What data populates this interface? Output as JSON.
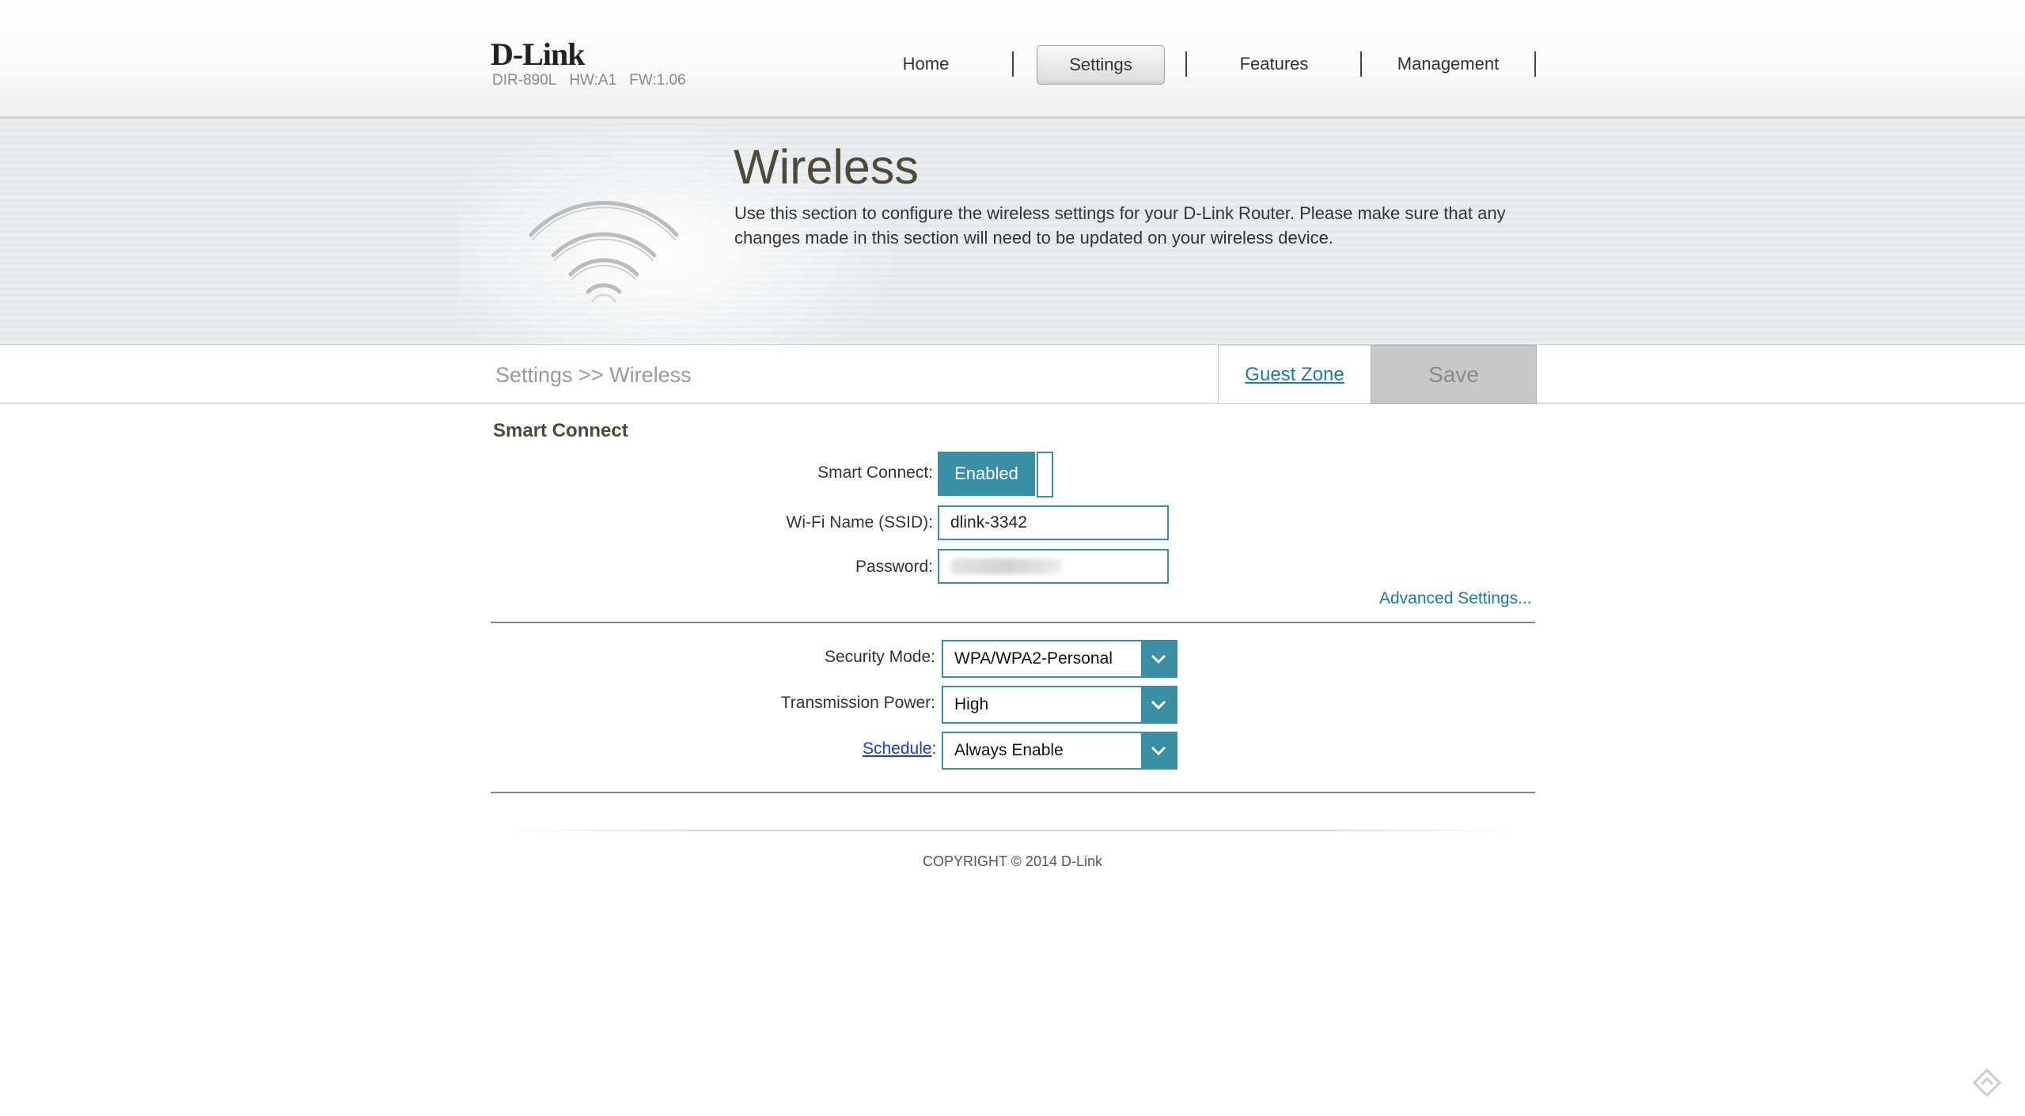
{
  "header": {
    "logo": "D-Link",
    "model": "DIR-890L",
    "hw": "HW:A1",
    "fw": "FW:1.06",
    "nav": [
      "Home",
      "Settings",
      "Features",
      "Management"
    ],
    "active_nav": "Settings"
  },
  "banner": {
    "title": "Wireless",
    "description": "Use this section to configure the wireless settings for your D-Link Router. Please make sure that any changes made in this section will need to be updated on your wireless device."
  },
  "toolbar": {
    "breadcrumb": "Settings >> Wireless",
    "guest_zone_label": "Guest Zone",
    "save_label": "Save"
  },
  "smart_connect": {
    "section_title": "Smart Connect",
    "smart_connect_label": "Smart Connect:",
    "smart_connect_value": "Enabled",
    "ssid_label": "Wi-Fi Name (SSID):",
    "ssid_value": "dlink-3342",
    "password_label": "Password:",
    "advanced_link": "Advanced Settings..."
  },
  "wireless": {
    "security_mode_label": "Security Mode:",
    "security_mode_value": "WPA/WPA2-Personal",
    "tx_power_label": "Transmission Power:",
    "tx_power_value": "High",
    "schedule_label": "Schedule",
    "schedule_colon": ":",
    "schedule_value": "Always Enable"
  },
  "footer": {
    "copyright": "COPYRIGHT © 2014 D-Link"
  },
  "colors": {
    "accent": "#3b8fa5",
    "link": "#1e7a9b",
    "title": "#4d4b38"
  }
}
